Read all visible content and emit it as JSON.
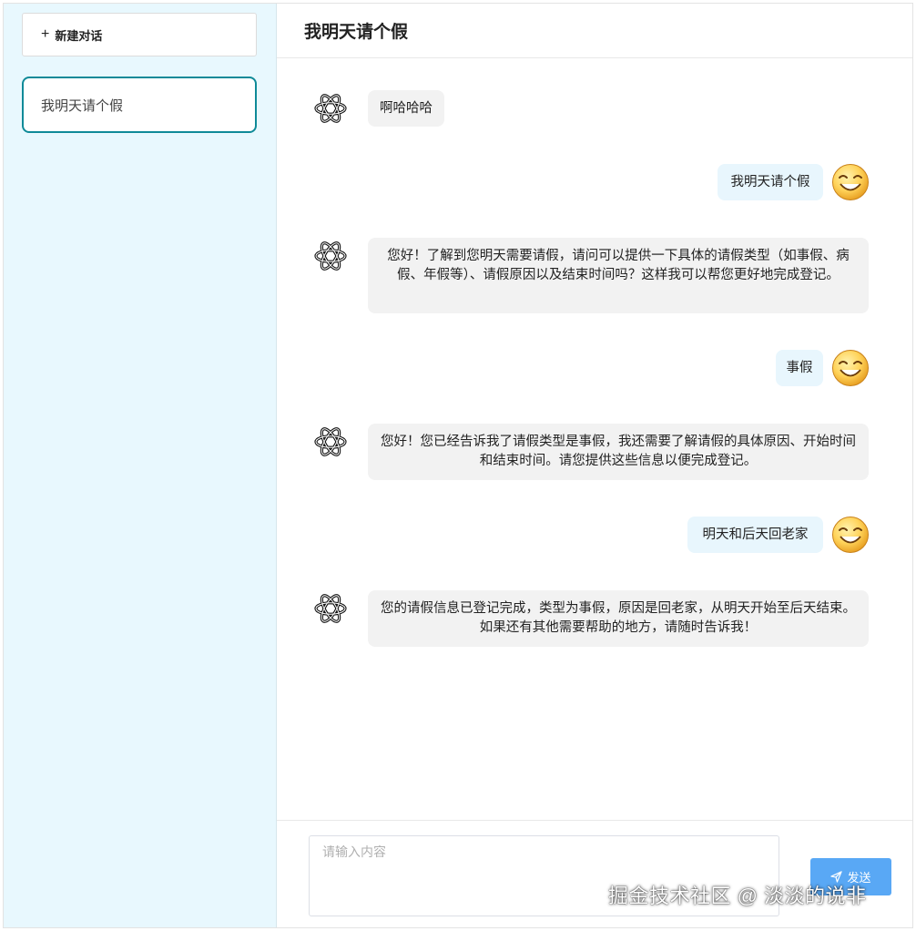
{
  "sidebar": {
    "new_chat_icon": "+",
    "new_chat_label": "新建对话",
    "conversations": [
      {
        "title": "我明天请个假"
      }
    ]
  },
  "chat": {
    "title": "我明天请个假",
    "messages": [
      {
        "role": "assistant",
        "avatar_icon": "openai-logo-icon",
        "text": "啊哈哈哈"
      },
      {
        "role": "user",
        "avatar_icon": "smiley-face-icon",
        "text": "我明天请个假"
      },
      {
        "role": "assistant",
        "avatar_icon": "openai-logo-icon",
        "text": "您好！了解到您明天需要请假，请问可以提供一下具体的请假类型（如事假、病假、年假等）、请假原因以及结束时间吗？这样我可以帮您更好地完成登记。"
      },
      {
        "role": "user",
        "avatar_icon": "smiley-face-icon",
        "text": "事假"
      },
      {
        "role": "assistant",
        "avatar_icon": "openai-logo-icon",
        "text": "您好！您已经告诉我了请假类型是事假，我还需要了解请假的具体原因、开始时间和结束时间。请您提供这些信息以便完成登记。"
      },
      {
        "role": "user",
        "avatar_icon": "smiley-face-icon",
        "text": "明天和后天回老家"
      },
      {
        "role": "assistant",
        "avatar_icon": "openai-logo-icon",
        "text": "您的请假信息已登记完成，类型为事假，原因是回老家，从明天开始至后天结束。如果还有其他需要帮助的地方，请随时告诉我！"
      }
    ]
  },
  "composer": {
    "placeholder": "请输入内容",
    "value": "",
    "send_label": "发送",
    "send_icon": "send-icon"
  },
  "watermark": "掘金技术社区 @ 淡淡的说非",
  "colors": {
    "sidebar_bg": "#e8f8fe",
    "active_border": "#0f8a98",
    "assistant_bubble": "#f2f2f2",
    "user_bubble": "#e8f6fd",
    "send_button": "#59a8f5"
  }
}
